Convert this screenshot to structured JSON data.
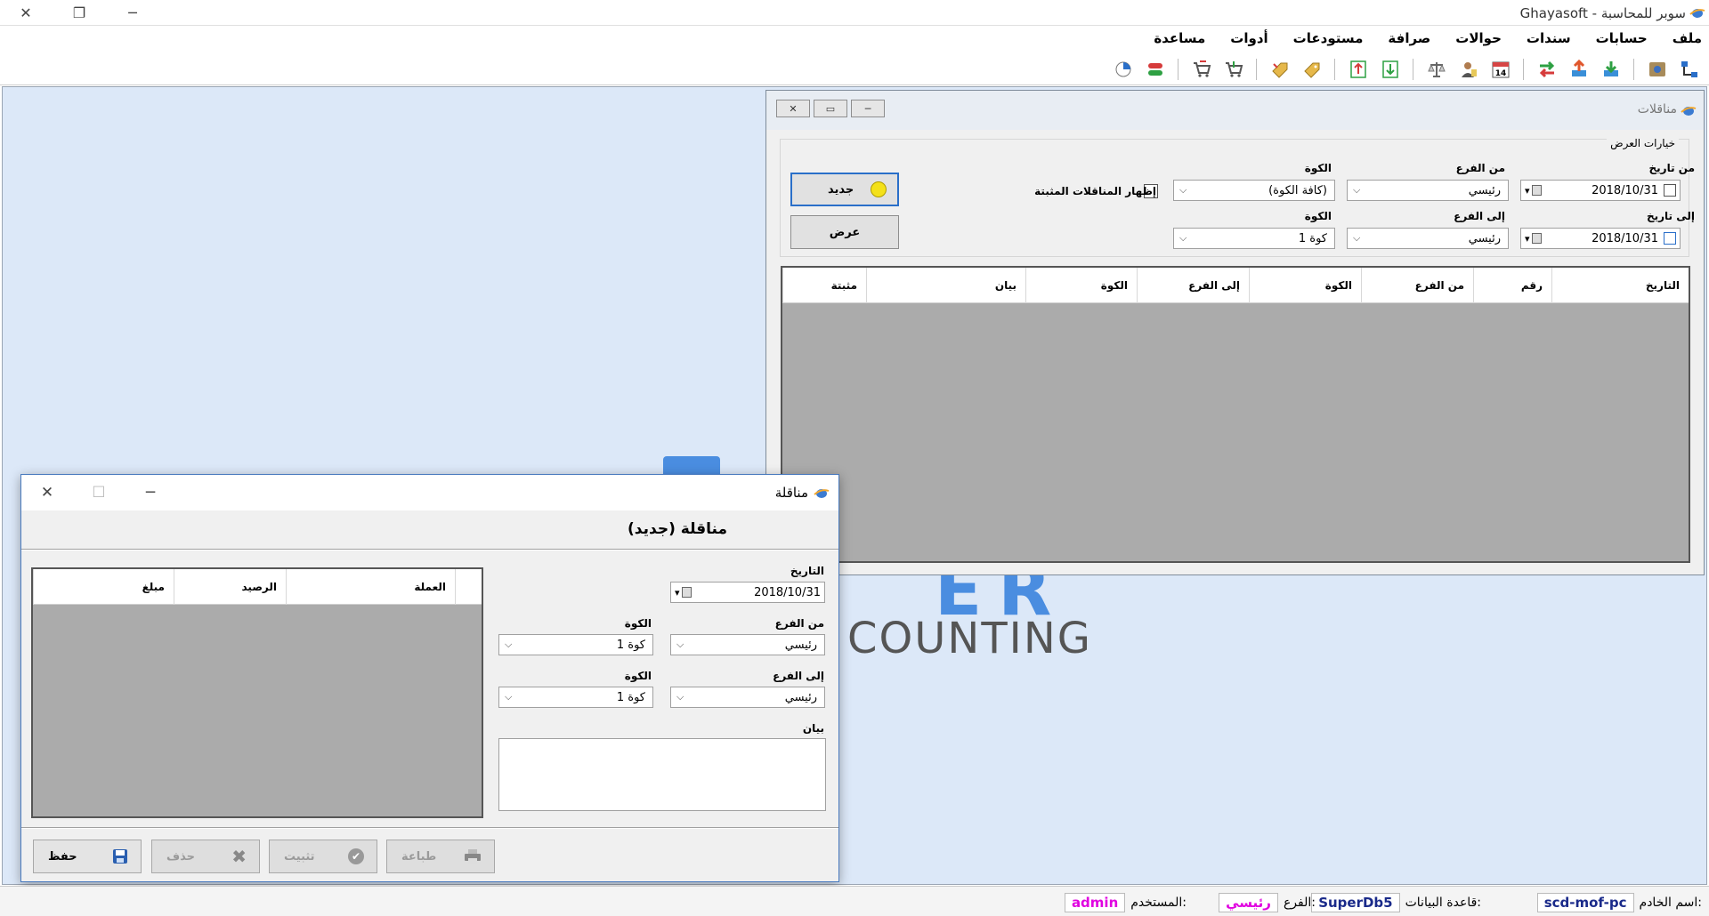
{
  "app": {
    "title": "Ghayasoft - سوبر للمحاسبة"
  },
  "menu": [
    "ملف",
    "حسابات",
    "سندات",
    "حوالات",
    "صرافة",
    "مستودعات",
    "أدوات",
    "مساعدة"
  ],
  "toolbar_icons": [
    "network-icon",
    "settings-icon",
    "sep",
    "download-icon",
    "upload-icon",
    "exchange-icon",
    "sep",
    "calendar-icon",
    "user-icon",
    "scale-icon",
    "sep",
    "import-icon",
    "export-icon",
    "sep",
    "tag-icon",
    "tag-add-icon",
    "sep",
    "cart-icon",
    "cart-remove-icon",
    "sep",
    "transfer-icon",
    "pie-chart-icon"
  ],
  "listing_window": {
    "title": "مناقلات",
    "options_legend": "خيارات العرض",
    "from_date_label": "من تاريخ",
    "from_date": "2018/10/31",
    "to_date_label": "إلى تاريخ",
    "to_date": "2018/10/31",
    "from_branch_label": "من الفرع",
    "from_branch": "رئيسي",
    "to_branch_label": "إلى الفرع",
    "to_branch": "رئيسي",
    "box_label_1": "الكوة",
    "box_value_1": "(كافة الكوة)",
    "box_label_2": "الكوة",
    "box_value_2": "كوة 1",
    "show_fixed_label": "إظهار المناقلات المثبتة",
    "new_button": "جديد",
    "view_button": "عرض",
    "columns": [
      "التاريخ",
      "رقم",
      "من الفرع",
      "الكوة",
      "إلى الفرع",
      "الكوة",
      "بيان",
      "مثبتة"
    ]
  },
  "watermark": {
    "line1": "ER",
    "line2": "COUNTING"
  },
  "dialog": {
    "title": "مناقلة",
    "heading": "مناقلة (جديد)",
    "date_label": "التاريخ",
    "date_value": "2018/10/31",
    "from_branch_label": "من الفرع",
    "from_branch": "رئيسي",
    "from_box_label": "الكوة",
    "from_box": "كوة 1",
    "to_branch_label": "إلى الفرع",
    "to_branch": "رئيسي",
    "to_box_label": "الكوة",
    "to_box": "كوة 1",
    "statement_label": "بيان",
    "grid_columns": [
      "العملة",
      "الرصيد",
      "مبلغ"
    ],
    "buttons": {
      "save": "حفظ",
      "delete": "حذف",
      "confirm": "تثبيت",
      "print": "طباعة"
    }
  },
  "status": {
    "server_label": "اسم الخادم:",
    "server_value": "scd-mof-pc",
    "db_label": "قاعدة البيانات:",
    "db_value": "SuperDb5",
    "branch_label": "الفرع:",
    "branch_value": "رئيسي",
    "user_label": "المستخدم:",
    "user_value": "admin",
    "colors": {
      "server": "#1a2a8a",
      "db": "#1a2a8a",
      "branch": "#e000e0",
      "user": "#e000e0"
    }
  }
}
